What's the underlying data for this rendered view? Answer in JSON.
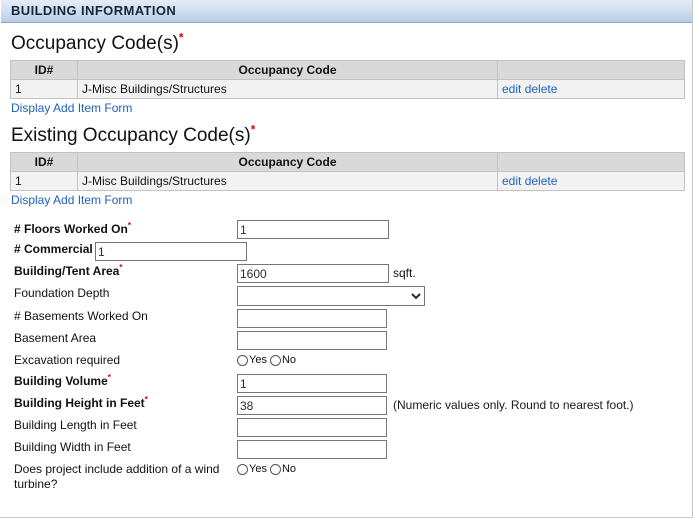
{
  "section": {
    "title": "BUILDING INFORMATION"
  },
  "occupancy": {
    "heading": "Occupancy Code(s)",
    "required_marker": "*",
    "columns": [
      "ID#",
      "Occupancy Code",
      ""
    ],
    "rows": [
      {
        "id": "1",
        "code": "J-Misc Buildings/Structures",
        "edit": "edit",
        "delete": "delete"
      }
    ],
    "add_item_link": "Display Add Item Form"
  },
  "existing_occupancy": {
    "heading": "Existing Occupancy Code(s)",
    "required_marker": "*",
    "columns": [
      "ID#",
      "Occupancy Code",
      ""
    ],
    "rows": [
      {
        "id": "1",
        "code": "J-Misc Buildings/Structures",
        "edit": "edit",
        "delete": "delete"
      }
    ],
    "add_item_link": "Display Add Item Form"
  },
  "form": {
    "floors_label": "# Floors Worked On",
    "floors_value": "1",
    "commercial_units_label": "# Commercial Units Worked On",
    "commercial_units_value": "1",
    "building_area_label": "Building/Tent Area",
    "building_area_value": "1600",
    "building_area_unit": "sqft.",
    "foundation_depth_label": "Foundation Depth",
    "foundation_depth_value": "",
    "foundation_depth_options": [
      ""
    ],
    "basements_label": "# Basements Worked On",
    "basements_value": "",
    "basement_area_label": "Basement Area",
    "basement_area_value": "",
    "excavation_label": "Excavation required",
    "excavation_yes": "Yes",
    "excavation_no": "No",
    "building_volume_label": "Building Volume",
    "building_volume_value": "1",
    "building_height_label": "Building Height in Feet",
    "building_height_value": "38",
    "building_height_hint": "(Numeric values only. Round to nearest foot.)",
    "building_length_label": "Building Length in Feet",
    "building_length_value": "",
    "building_width_label": "Building Width in Feet",
    "building_width_value": "",
    "wind_turbine_label": "Does project include addition of a wind turbine?",
    "wind_turbine_yes": "Yes",
    "wind_turbine_no": "No",
    "required_marker": "*"
  },
  "colors": {
    "header_gradient_top": "#e4ecf7",
    "header_gradient_bottom": "#b9cbe6",
    "required_red": "#e60000",
    "link_blue": "#2060c0",
    "table_header_gray": "#d9d9d9",
    "table_row_gray": "#f2f2f2"
  }
}
